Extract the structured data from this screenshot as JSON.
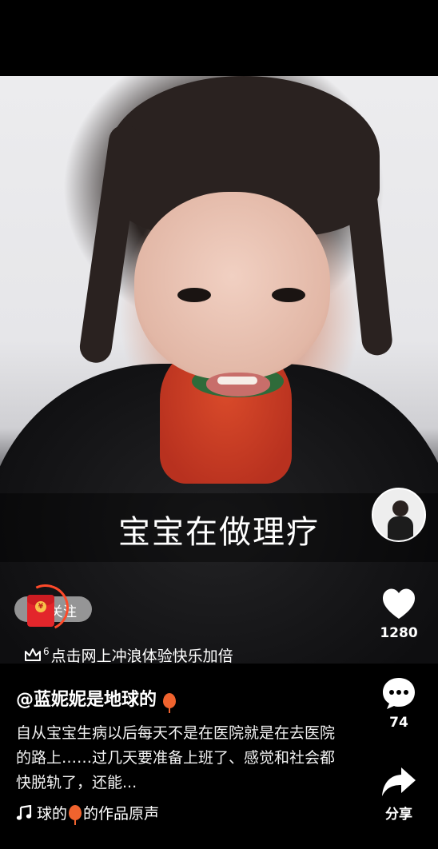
{
  "video": {
    "caption": "宝宝在做理疗"
  },
  "right_rail": {
    "like_count": "1280",
    "comment_count": "74",
    "share_label": "分享"
  },
  "follow": {
    "label": "关注"
  },
  "red_packet": {
    "coin_label": "¥"
  },
  "promo": {
    "rank": "6",
    "text": "点击网上冲浪体验快乐加倍"
  },
  "author": {
    "username": "@蓝妮妮是地球的",
    "username_emoji": "balloon-icon"
  },
  "description": "自从宝宝生病以后每天不是在医院就是在去医院的路上……过几天要准备上班了、感觉和社会都快脱轨了，还能...",
  "music": {
    "prefix": "球的",
    "suffix": "的作品原声"
  },
  "colors": {
    "background": "#000000",
    "accent_red": "#e3262b",
    "balloon": "#f0632e"
  }
}
